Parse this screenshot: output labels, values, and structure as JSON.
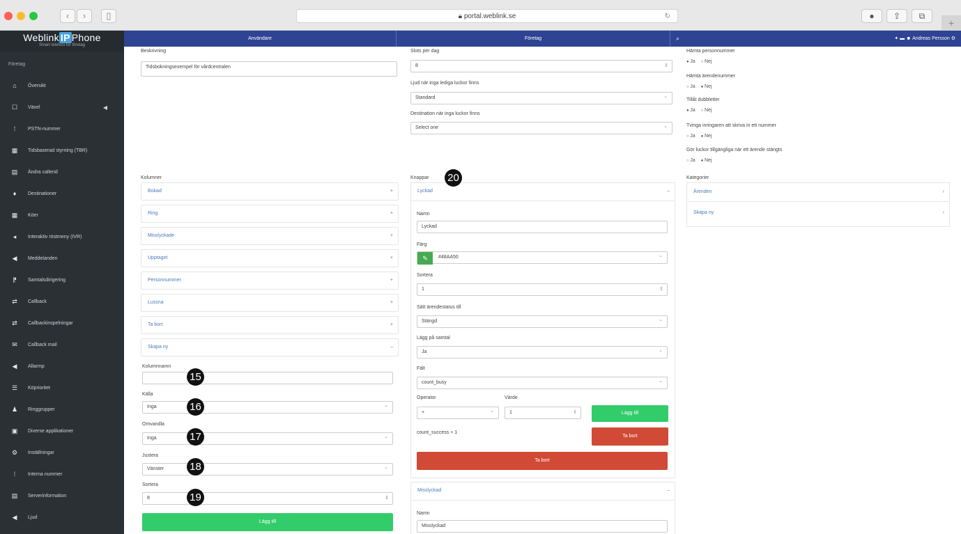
{
  "browser": {
    "url": "portal.weblink.se",
    "lock_icon": "lock-icon",
    "reload": "↻"
  },
  "sidebar": {
    "logo_a": "Weblink",
    "logo_b": "IP",
    "logo_c": "Phone",
    "tagline": "Smart telefoni för företag",
    "crumb": "Företag",
    "items": [
      {
        "icon": "home-icon",
        "glyph": "⌂",
        "label": "Översikt"
      },
      {
        "icon": "phone-icon",
        "glyph": "☐",
        "label": "Växel",
        "caret": "◀"
      },
      {
        "icon": "number-icon",
        "glyph": "⁞",
        "label": "PSTN-nummer"
      },
      {
        "icon": "calendar-icon",
        "glyph": "▦",
        "label": "Tidsbaserad styrning (TBR)"
      },
      {
        "icon": "id-card-icon",
        "glyph": "▤",
        "label": "Ändra callerid"
      },
      {
        "icon": "map-pin-icon",
        "glyph": "♦",
        "label": "Destinationer"
      },
      {
        "icon": "list-icon",
        "glyph": "▦",
        "label": "Köer"
      },
      {
        "icon": "share-icon",
        "glyph": "◂",
        "label": "Interaktiv röstmeny (IVR)"
      },
      {
        "icon": "megaphone-icon",
        "glyph": "◀",
        "label": "Meddelanden"
      },
      {
        "icon": "forward-icon",
        "glyph": "⁋",
        "label": "Samtalsdirigering"
      },
      {
        "icon": "exchange-icon",
        "glyph": "⇄",
        "label": "Callback"
      },
      {
        "icon": "exchange-icon",
        "glyph": "⇄",
        "label": "Callbackinspelningar"
      },
      {
        "icon": "mail-icon",
        "glyph": "✉",
        "label": "Callback mail"
      },
      {
        "icon": "volume-icon",
        "glyph": "◀",
        "label": "Allarmp"
      },
      {
        "icon": "list-icon",
        "glyph": "☰",
        "label": "Köprioritet"
      },
      {
        "icon": "users-icon",
        "glyph": "♟",
        "label": "Ringgrupper"
      },
      {
        "icon": "apps-icon",
        "glyph": "▣",
        "label": "Diverse applikationer"
      },
      {
        "icon": "cogs-icon",
        "glyph": "⚙",
        "label": "Inställningar"
      },
      {
        "icon": "number-icon",
        "glyph": "⁞",
        "label": "Interna nummer"
      },
      {
        "icon": "server-icon",
        "glyph": "▤",
        "label": "Serverinformation"
      },
      {
        "icon": "speaker-icon",
        "glyph": "◀",
        "label": "Ljud"
      }
    ]
  },
  "topnav": {
    "users": "Användare",
    "company": "Företag",
    "search_icon": "⌕",
    "right_text": "Andreas Persson",
    "right_icons": "✦ ▬ ☻"
  },
  "col1": {
    "desc_label": "Beskrivning",
    "desc_value": "Tidsbokningsexempel för vårdcentralen",
    "columns_label": "Kolumner",
    "columns": [
      "Bokad",
      "Ring",
      "Misslyckade",
      "Upptaget",
      "Personnummer",
      "Lussna",
      "Ta bort",
      "Skapa ny"
    ],
    "colname_label": "Kolumnnamn",
    "colname_value": "",
    "source_label": "Källa",
    "source_value": "Inga",
    "convert_label": "Omvandla",
    "convert_value": "Inga",
    "align_label": "Justera",
    "align_value": "Vänster",
    "sort_label": "Sortera",
    "sort_value": "8",
    "add_btn": "Lägg till"
  },
  "col2": {
    "slots_label": "Slots per dag",
    "slots_value": "8",
    "sound_label": "Ljud när inga lediga luckor finns",
    "sound_value": "Standard",
    "dest_label": "Destination när inga luckor finns",
    "dest_value": "Select one",
    "buttons_label": "Knappar",
    "btn1_header": "Lyckad",
    "name_label": "Namn",
    "name_value": "Lyckad",
    "color_label": "Färg",
    "color_value": "#48AA50",
    "color_hex": "#48aa50",
    "pencil": "✎",
    "sort_label": "Sortera",
    "sort_value": "1",
    "status_label": "Sätt ärendestatus till",
    "status_value": "Stängd",
    "hangup_label": "Lägg på samtal",
    "hangup_value": "Ja",
    "field_label": "Fält",
    "field_value": "count_busy",
    "op_label": "Operator",
    "op_value": "+",
    "val_label": "Värde",
    "val_value": "1",
    "add_btn": "Lägg till",
    "remove_btn": "Ta bort",
    "formula": "count_success + 1",
    "remove_all_btn": "Ta bort",
    "btn2_header": "Misslyckad",
    "name2_label": "Namn",
    "name2_value": "Misslyckad"
  },
  "col3": {
    "q1_label": "Hämta personnummer",
    "q1_yes": "Ja",
    "q1_no": "Nej",
    "q2_label": "Hämta ärendenummer",
    "q2_yes": "Ja",
    "q2_no": "Nej",
    "q3_label": "Tillåt dubbletter",
    "q3_yes": "Ja",
    "q3_no": "Nej",
    "q4_label": "Tvinga inringaren att skriva in ett nummer",
    "q4_yes": "Ja",
    "q4_no": "Nej",
    "q5_label": "Gör luckor tillgängliga när ett ärende stängts",
    "q5_yes": "Ja",
    "q5_no": "Nej",
    "categories_label": "Kategorier",
    "categories": [
      "Ärenden",
      "Skapa ny"
    ]
  },
  "badges": [
    "15",
    "16",
    "17",
    "18",
    "19",
    "20"
  ]
}
